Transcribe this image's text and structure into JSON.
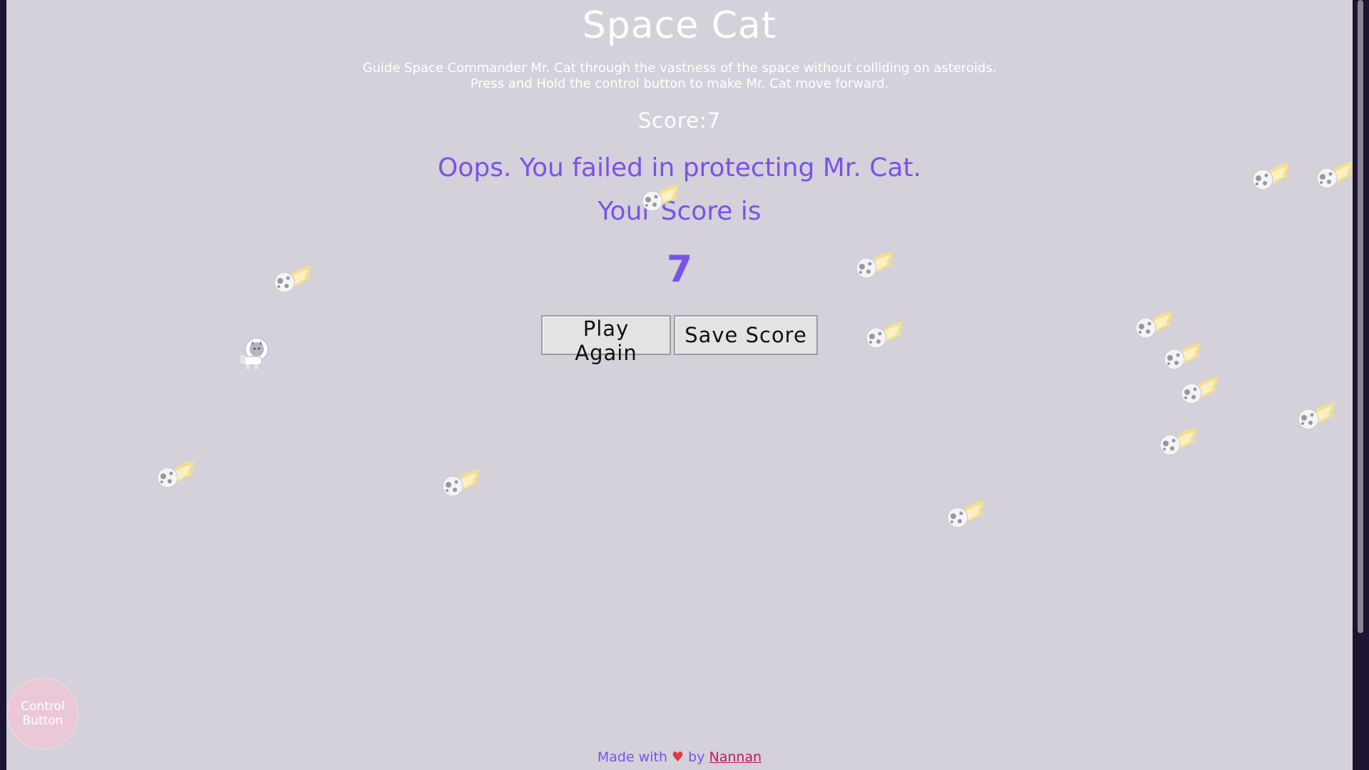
{
  "game": {
    "title": "Space Cat",
    "description_line1": "Guide Space Commander Mr. Cat through the vastness of the space without colliding on asteroids.",
    "description_line2": "Press and Hold the control button to make Mr. Cat move forward.",
    "score_label": "Score:",
    "score_value": "7",
    "fail_message": "Oops. You failed in protecting Mr. Cat.",
    "your_score_label": "Your Score is",
    "final_score": "7"
  },
  "buttons": {
    "play_again": "Play Again",
    "save_score": "Save Score",
    "control_line1": "Control",
    "control_line2": "Button"
  },
  "footer": {
    "made_with": "Made with",
    "heart": "♥",
    "by": "by",
    "author": "Nannan"
  },
  "icons": {
    "asteroid": "flaming-asteroid-icon",
    "cat": "space-cat-icon"
  },
  "colors": {
    "background": "#d4d1da",
    "accent": "#7b52e8",
    "control_button": "#ebc8d8",
    "author_link": "#c2185b"
  }
}
